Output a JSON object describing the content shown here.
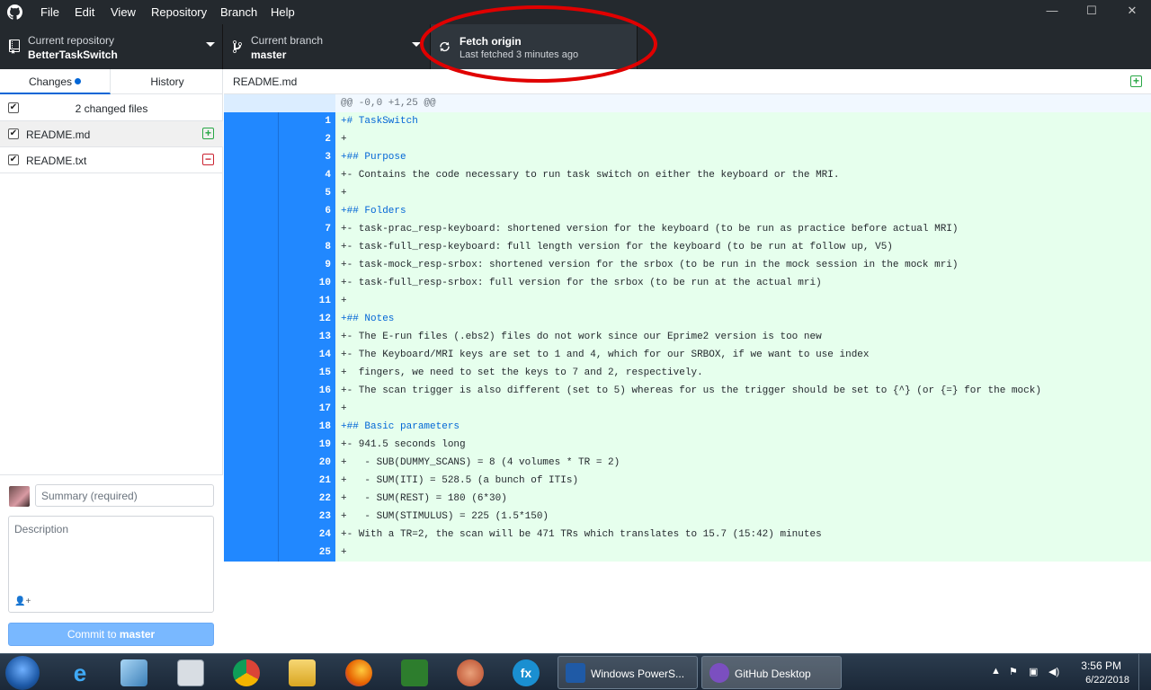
{
  "menu": {
    "items": [
      "File",
      "Edit",
      "View",
      "Repository",
      "Branch",
      "Help"
    ]
  },
  "window_controls": {
    "minimize": "—",
    "maximize": "☐",
    "close": "✕"
  },
  "toolbar": {
    "repository": {
      "title": "Current repository",
      "value": "BetterTaskSwitch"
    },
    "branch": {
      "title": "Current branch",
      "value": "master"
    },
    "fetch": {
      "title": "Fetch origin",
      "subtitle": "Last fetched 3 minutes ago"
    }
  },
  "sidebar": {
    "tabs": {
      "changes": "Changes",
      "history": "History"
    },
    "changed_files_label": "2 changed files",
    "files": [
      {
        "name": "README.md",
        "status": "added"
      },
      {
        "name": "README.txt",
        "status": "deleted"
      }
    ],
    "commit": {
      "summary_placeholder": "Summary (required)",
      "description_placeholder": "Description",
      "button_prefix": "Commit to ",
      "button_branch": "master"
    }
  },
  "diff": {
    "filename": "README.md",
    "hunk_header": "@@ -0,0 +1,25 @@",
    "lines": [
      {
        "n": "1",
        "text": "+# TaskSwitch",
        "heading": true
      },
      {
        "n": "2",
        "text": "+"
      },
      {
        "n": "3",
        "text": "+## Purpose",
        "heading": true
      },
      {
        "n": "4",
        "text": "+- Contains the code necessary to run task switch on either the keyboard or the MRI."
      },
      {
        "n": "5",
        "text": "+"
      },
      {
        "n": "6",
        "text": "+## Folders",
        "heading": true
      },
      {
        "n": "7",
        "text": "+- task-prac_resp-keyboard: shortened version for the keyboard (to be run as practice before actual MRI)"
      },
      {
        "n": "8",
        "text": "+- task-full_resp-keyboard: full length version for the keyboard (to be run at follow up, V5)"
      },
      {
        "n": "9",
        "text": "+- task-mock_resp-srbox: shortened version for the srbox (to be run in the mock session in the mock mri)"
      },
      {
        "n": "10",
        "text": "+- task-full_resp-srbox: full version for the srbox (to be run at the actual mri)"
      },
      {
        "n": "11",
        "text": "+"
      },
      {
        "n": "12",
        "text": "+## Notes",
        "heading": true
      },
      {
        "n": "13",
        "text": "+- The E-run files (.ebs2) files do not work since our Eprime2 version is too new"
      },
      {
        "n": "14",
        "text": "+- The Keyboard/MRI keys are set to 1 and 4, which for our SRBOX, if we want to use index"
      },
      {
        "n": "15",
        "text": "+  fingers, we need to set the keys to 7 and 2, respectively."
      },
      {
        "n": "16",
        "text": "+- The scan trigger is also different (set to 5) whereas for us the trigger should be set to {^} (or {=} for the mock)"
      },
      {
        "n": "17",
        "text": "+"
      },
      {
        "n": "18",
        "text": "+## Basic parameters",
        "heading": true
      },
      {
        "n": "19",
        "text": "+- 941.5 seconds long"
      },
      {
        "n": "20",
        "text": "+   - SUB(DUMMY_SCANS) = 8 (4 volumes * TR = 2)"
      },
      {
        "n": "21",
        "text": "+   - SUM(ITI) = 528.5 (a bunch of ITIs)"
      },
      {
        "n": "22",
        "text": "+   - SUM(REST) = 180 (6*30)"
      },
      {
        "n": "23",
        "text": "+   - SUM(STIMULUS) = 225 (1.5*150)"
      },
      {
        "n": "24",
        "text": "+- With a TR=2, the scan will be 471 TRs which translates to 15.7 (15:42) minutes"
      },
      {
        "n": "25",
        "text": "+"
      }
    ]
  },
  "taskbar": {
    "apps": [
      {
        "name": "windows-powershell",
        "label": "Windows PowerS..."
      },
      {
        "name": "github-desktop",
        "label": "GitHub Desktop"
      }
    ],
    "clock": {
      "time": "3:56 PM",
      "date": "6/22/2018"
    }
  },
  "colors": {
    "accent": "#0366d6",
    "added_bg": "#e6ffed",
    "gutter": "#2188ff",
    "annotation": "#e00000"
  }
}
